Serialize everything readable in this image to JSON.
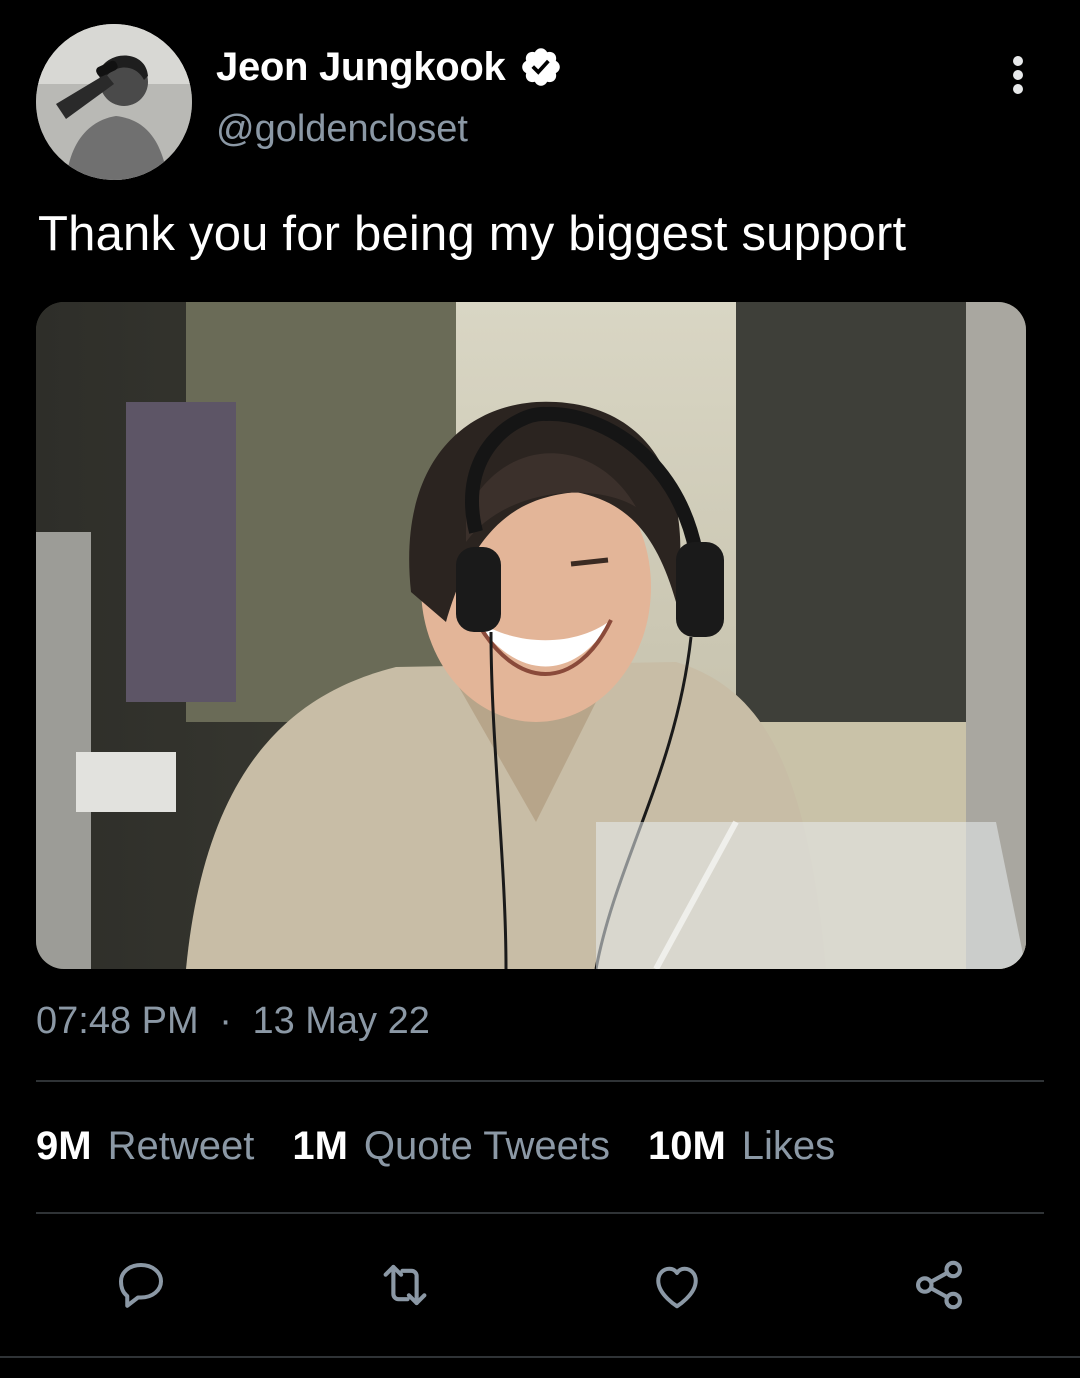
{
  "tweet": {
    "author": {
      "display_name": "Jeon Jungkook",
      "handle": "@goldencloset",
      "verified": true,
      "avatar_icon": "profile-photo"
    },
    "text": "Thank you for being my biggest support",
    "media": {
      "icon": "photo"
    },
    "time": "07:48 PM",
    "separator": "·",
    "date": "13 May 22",
    "stats": {
      "retweets": {
        "count": "9M",
        "label": "Retweet"
      },
      "quotes": {
        "count": "1M",
        "label": "Quote Tweets"
      },
      "likes": {
        "count": "10M",
        "label": "Likes"
      }
    },
    "actions": [
      "reply-icon",
      "retweet-icon",
      "like-icon",
      "share-icon"
    ]
  },
  "colors": {
    "background": "#000000",
    "primary_text": "#e7e9ea",
    "secondary_text": "#8b98a5",
    "divider": "#2f3336"
  }
}
